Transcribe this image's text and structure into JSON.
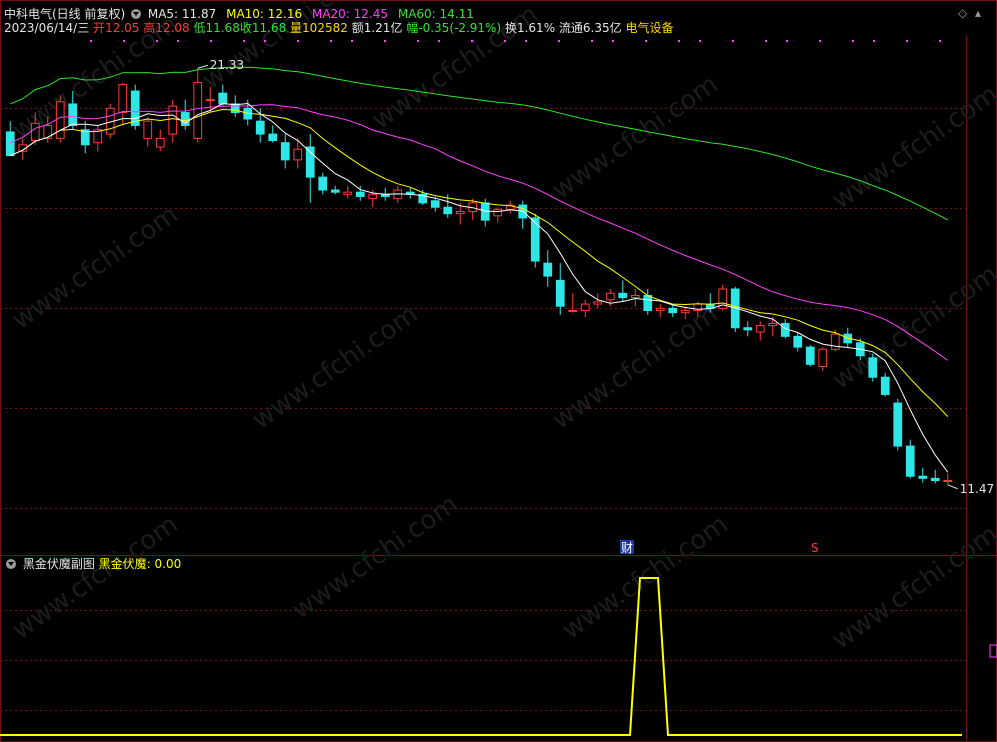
{
  "header": {
    "stock_title": "中科电气(日线 前复权)",
    "ma5_label": "MA5: 11.87",
    "ma10_label": "MA10: 12.16",
    "ma20_label": "MA20: 12.45",
    "ma60_label": "MA60: 14.11",
    "date": "2023/06/14/三",
    "open_label": "开",
    "open_value": "12.05",
    "high_label": "高",
    "high_value": "12.08",
    "low_label": "低",
    "low_value": "11.68",
    "close_label": "收",
    "close_value": "11.68",
    "volume_label": "量",
    "volume_value": "102582",
    "amount": "额1.21亿",
    "change_label": "幅",
    "change_value": "-0.35(-2.91%)",
    "turnover": "换1.61%",
    "float_cap": "流通6.35亿",
    "sector": "电气设备"
  },
  "sub_panel": {
    "title": "黑金伏魔副图",
    "indicator_label": "黑金伏魔: 0.00"
  },
  "markers": {
    "high_label": "21.33",
    "low_label": "11.47",
    "finance_badge": "财",
    "s_badge": "S"
  },
  "watermark": "www.cfchi.com",
  "colors": {
    "up": "#ff3b3b",
    "down": "#2ee6e6",
    "ma5": "#ffffff",
    "ma10": "#ffff00",
    "ma20": "#ff40ff",
    "ma60": "#2fe52f",
    "indicator": "#ffff00",
    "grid": "#7a1010"
  },
  "chart_data": [
    {
      "type": "candlestick",
      "title": "中科电气(日线 前复权)",
      "ylim": [
        10.6,
        21.8
      ],
      "ohlc": [
        {
          "o": 19.85,
          "h": 20.1,
          "l": 19.3,
          "c": 19.3
        },
        {
          "o": 19.4,
          "h": 19.7,
          "l": 19.2,
          "c": 19.55
        },
        {
          "o": 19.65,
          "h": 20.3,
          "l": 19.55,
          "c": 20.05
        },
        {
          "o": 19.7,
          "h": 20.2,
          "l": 19.6,
          "c": 20.0
        },
        {
          "o": 19.7,
          "h": 20.7,
          "l": 19.6,
          "c": 20.55
        },
        {
          "o": 20.5,
          "h": 20.8,
          "l": 19.9,
          "c": 20.0
        },
        {
          "o": 19.9,
          "h": 20.1,
          "l": 19.35,
          "c": 19.55
        },
        {
          "o": 19.6,
          "h": 20.0,
          "l": 19.4,
          "c": 19.9
        },
        {
          "o": 19.8,
          "h": 20.5,
          "l": 19.7,
          "c": 20.4
        },
        {
          "o": 20.3,
          "h": 21.0,
          "l": 20.0,
          "c": 20.95
        },
        {
          "o": 20.8,
          "h": 20.95,
          "l": 19.9,
          "c": 20.0
        },
        {
          "o": 19.7,
          "h": 20.2,
          "l": 19.5,
          "c": 20.1
        },
        {
          "o": 19.5,
          "h": 19.9,
          "l": 19.4,
          "c": 19.7
        },
        {
          "o": 19.8,
          "h": 20.6,
          "l": 19.6,
          "c": 20.45
        },
        {
          "o": 20.3,
          "h": 20.6,
          "l": 19.9,
          "c": 20.0
        },
        {
          "o": 19.7,
          "h": 21.33,
          "l": 19.6,
          "c": 21.0
        },
        {
          "o": 20.6,
          "h": 20.9,
          "l": 20.3,
          "c": 20.6
        },
        {
          "o": 20.75,
          "h": 20.95,
          "l": 20.45,
          "c": 20.5
        },
        {
          "o": 20.5,
          "h": 20.7,
          "l": 20.2,
          "c": 20.3
        },
        {
          "o": 20.4,
          "h": 20.6,
          "l": 20.0,
          "c": 20.15
        },
        {
          "o": 20.1,
          "h": 20.4,
          "l": 19.6,
          "c": 19.8
        },
        {
          "o": 19.8,
          "h": 20.0,
          "l": 19.6,
          "c": 19.65
        },
        {
          "o": 19.6,
          "h": 19.8,
          "l": 19.0,
          "c": 19.2
        },
        {
          "o": 19.2,
          "h": 19.7,
          "l": 19.0,
          "c": 19.45
        },
        {
          "o": 19.5,
          "h": 19.8,
          "l": 18.2,
          "c": 18.8
        },
        {
          "o": 18.8,
          "h": 18.9,
          "l": 18.4,
          "c": 18.5
        },
        {
          "o": 18.5,
          "h": 18.6,
          "l": 18.4,
          "c": 18.45
        },
        {
          "o": 18.4,
          "h": 18.6,
          "l": 18.3,
          "c": 18.45
        },
        {
          "o": 18.45,
          "h": 18.6,
          "l": 18.25,
          "c": 18.35
        },
        {
          "o": 18.3,
          "h": 18.5,
          "l": 18.1,
          "c": 18.4
        },
        {
          "o": 18.4,
          "h": 18.55,
          "l": 18.25,
          "c": 18.35
        },
        {
          "o": 18.3,
          "h": 18.6,
          "l": 18.2,
          "c": 18.5
        },
        {
          "o": 18.45,
          "h": 18.55,
          "l": 18.3,
          "c": 18.4
        },
        {
          "o": 18.4,
          "h": 18.5,
          "l": 18.15,
          "c": 18.2
        },
        {
          "o": 18.25,
          "h": 18.35,
          "l": 18.0,
          "c": 18.1
        },
        {
          "o": 18.1,
          "h": 18.4,
          "l": 17.85,
          "c": 17.95
        },
        {
          "o": 17.95,
          "h": 18.2,
          "l": 17.7,
          "c": 18.0
        },
        {
          "o": 18.0,
          "h": 18.3,
          "l": 17.8,
          "c": 18.2
        },
        {
          "o": 18.2,
          "h": 18.3,
          "l": 17.65,
          "c": 17.8
        },
        {
          "o": 17.9,
          "h": 18.1,
          "l": 17.75,
          "c": 18.05
        },
        {
          "o": 18.05,
          "h": 18.25,
          "l": 17.95,
          "c": 18.15
        },
        {
          "o": 18.15,
          "h": 18.25,
          "l": 17.6,
          "c": 17.85
        },
        {
          "o": 17.85,
          "h": 17.95,
          "l": 16.7,
          "c": 16.85
        },
        {
          "o": 16.8,
          "h": 17.1,
          "l": 16.25,
          "c": 16.5
        },
        {
          "o": 16.4,
          "h": 16.8,
          "l": 15.6,
          "c": 15.8
        },
        {
          "o": 15.7,
          "h": 16.1,
          "l": 15.65,
          "c": 15.7
        },
        {
          "o": 15.7,
          "h": 15.95,
          "l": 15.55,
          "c": 15.85
        },
        {
          "o": 15.85,
          "h": 16.1,
          "l": 15.75,
          "c": 15.9
        },
        {
          "o": 15.95,
          "h": 16.2,
          "l": 15.8,
          "c": 16.1
        },
        {
          "o": 16.1,
          "h": 16.4,
          "l": 15.9,
          "c": 16.0
        },
        {
          "o": 16.0,
          "h": 16.2,
          "l": 15.8,
          "c": 16.05
        },
        {
          "o": 16.05,
          "h": 16.2,
          "l": 15.6,
          "c": 15.7
        },
        {
          "o": 15.7,
          "h": 15.85,
          "l": 15.55,
          "c": 15.75
        },
        {
          "o": 15.75,
          "h": 15.85,
          "l": 15.55,
          "c": 15.65
        },
        {
          "o": 15.65,
          "h": 15.8,
          "l": 15.5,
          "c": 15.7
        },
        {
          "o": 15.7,
          "h": 15.9,
          "l": 15.55,
          "c": 15.85
        },
        {
          "o": 15.85,
          "h": 16.1,
          "l": 15.65,
          "c": 15.75
        },
        {
          "o": 15.75,
          "h": 16.3,
          "l": 15.7,
          "c": 16.2
        },
        {
          "o": 16.2,
          "h": 16.25,
          "l": 15.2,
          "c": 15.3
        },
        {
          "o": 15.3,
          "h": 15.45,
          "l": 15.1,
          "c": 15.25
        },
        {
          "o": 15.2,
          "h": 15.45,
          "l": 15.0,
          "c": 15.35
        },
        {
          "o": 15.35,
          "h": 15.55,
          "l": 15.1,
          "c": 15.4
        },
        {
          "o": 15.4,
          "h": 15.5,
          "l": 15.05,
          "c": 15.1
        },
        {
          "o": 15.1,
          "h": 15.2,
          "l": 14.75,
          "c": 14.85
        },
        {
          "o": 14.85,
          "h": 14.9,
          "l": 14.4,
          "c": 14.45
        },
        {
          "o": 14.4,
          "h": 14.85,
          "l": 14.3,
          "c": 14.8
        },
        {
          "o": 14.8,
          "h": 15.25,
          "l": 14.75,
          "c": 15.15
        },
        {
          "o": 15.15,
          "h": 15.3,
          "l": 14.85,
          "c": 14.95
        },
        {
          "o": 14.95,
          "h": 15.05,
          "l": 14.55,
          "c": 14.65
        },
        {
          "o": 14.6,
          "h": 14.7,
          "l": 14.05,
          "c": 14.15
        },
        {
          "o": 14.15,
          "h": 14.25,
          "l": 13.7,
          "c": 13.75
        },
        {
          "o": 13.55,
          "h": 13.65,
          "l": 12.45,
          "c": 12.55
        },
        {
          "o": 12.55,
          "h": 12.7,
          "l": 11.8,
          "c": 11.85
        },
        {
          "o": 11.85,
          "h": 12.05,
          "l": 11.7,
          "c": 11.8
        },
        {
          "o": 11.8,
          "h": 12.0,
          "l": 11.68,
          "c": 11.75
        },
        {
          "o": 11.75,
          "h": 11.9,
          "l": 11.65,
          "c": 11.75
        }
      ],
      "ma5": [],
      "ma10": [],
      "ma20": [],
      "ma60": []
    },
    {
      "type": "line",
      "title": "黑金伏魔副图",
      "series": [
        {
          "name": "黑金伏魔",
          "values": [
            0,
            0,
            0,
            0,
            0,
            0,
            0,
            0,
            0,
            0,
            1,
            1,
            0,
            0,
            0,
            0,
            0,
            0,
            0,
            0
          ]
        }
      ]
    }
  ]
}
